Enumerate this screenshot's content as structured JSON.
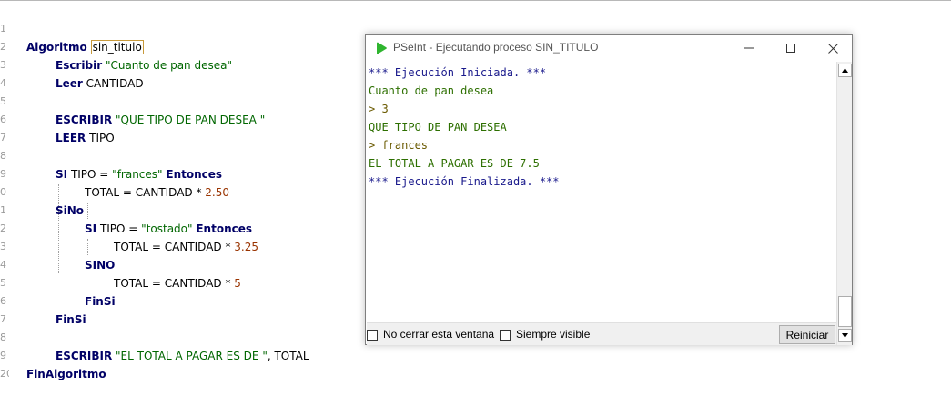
{
  "editor": {
    "line_numbers": [
      "1",
      "2",
      "3",
      "4",
      "5",
      "6",
      "7",
      "8",
      "9",
      "0",
      "1",
      "2",
      "3",
      "4",
      "5",
      "6",
      "7",
      "8",
      "9",
      "20"
    ],
    "lines": [
      {
        "kw1": "Algoritmo",
        "name": "sin_titulo"
      },
      {
        "kw1": "Escribir",
        "str": "\"Cuanto de pan desea\""
      },
      {
        "kw1": "Leer",
        "text": "CANTIDAD"
      },
      {},
      {
        "kw1": "ESCRIBIR",
        "str": "\"QUE TIPO DE PAN DESEA \""
      },
      {
        "kw1": "LEER",
        "text": "TIPO"
      },
      {},
      {
        "kw1": "SI",
        "text": "TIPO = ",
        "str": "\"frances\"",
        "kw2": "Entonces"
      },
      {
        "text": "TOTAL = CANTIDAD * ",
        "num": "2.50"
      },
      {
        "kw1": "SiNo"
      },
      {
        "kw1": "SI",
        "text": "TIPO = ",
        "str": "\"tostado\"",
        "kw2": "Entonces"
      },
      {
        "text": "TOTAL = CANTIDAD * ",
        "num": "3.25"
      },
      {
        "kw1": "SINO"
      },
      {
        "text": "TOTAL = CANTIDAD * ",
        "num": "5"
      },
      {
        "kw1": "FinSi"
      },
      {
        "kw1": "FinSi"
      },
      {},
      {
        "kw1": "ESCRIBIR",
        "str": "\"EL TOTAL A PAGAR ES DE \"",
        "text": ", TOTAL"
      },
      {
        "kw1": "FinAlgoritmo"
      },
      {}
    ]
  },
  "console": {
    "title": "PSeInt - Ejecutando proceso SIN_TITULO",
    "app_icon": "pseint-play-icon",
    "output": [
      {
        "text": "*** Ejecución Iniciada. ***",
        "kind": "sys"
      },
      {
        "text": "Cuanto de pan desea",
        "kind": "out"
      },
      {
        "text": "> 3",
        "kind": "in"
      },
      {
        "text": "QUE TIPO DE PAN DESEA",
        "kind": "out"
      },
      {
        "text": "> frances",
        "kind": "in"
      },
      {
        "text": "EL TOTAL A PAGAR ES DE 7.5",
        "kind": "out"
      },
      {
        "text": "*** Ejecución Finalizada. ***",
        "kind": "sys"
      }
    ],
    "checkbox_keep_open": "No cerrar esta ventana",
    "checkbox_always_visible": "Siempre visible",
    "restart_button": "Reiniciar"
  },
  "colors": {
    "keyword": "#000066",
    "string": "#006600",
    "number": "#993300",
    "system_output": "#1a1a8c",
    "program_output": "#2d6f00",
    "user_input": "#6a5a00",
    "app_icon": "#2fb52f"
  }
}
